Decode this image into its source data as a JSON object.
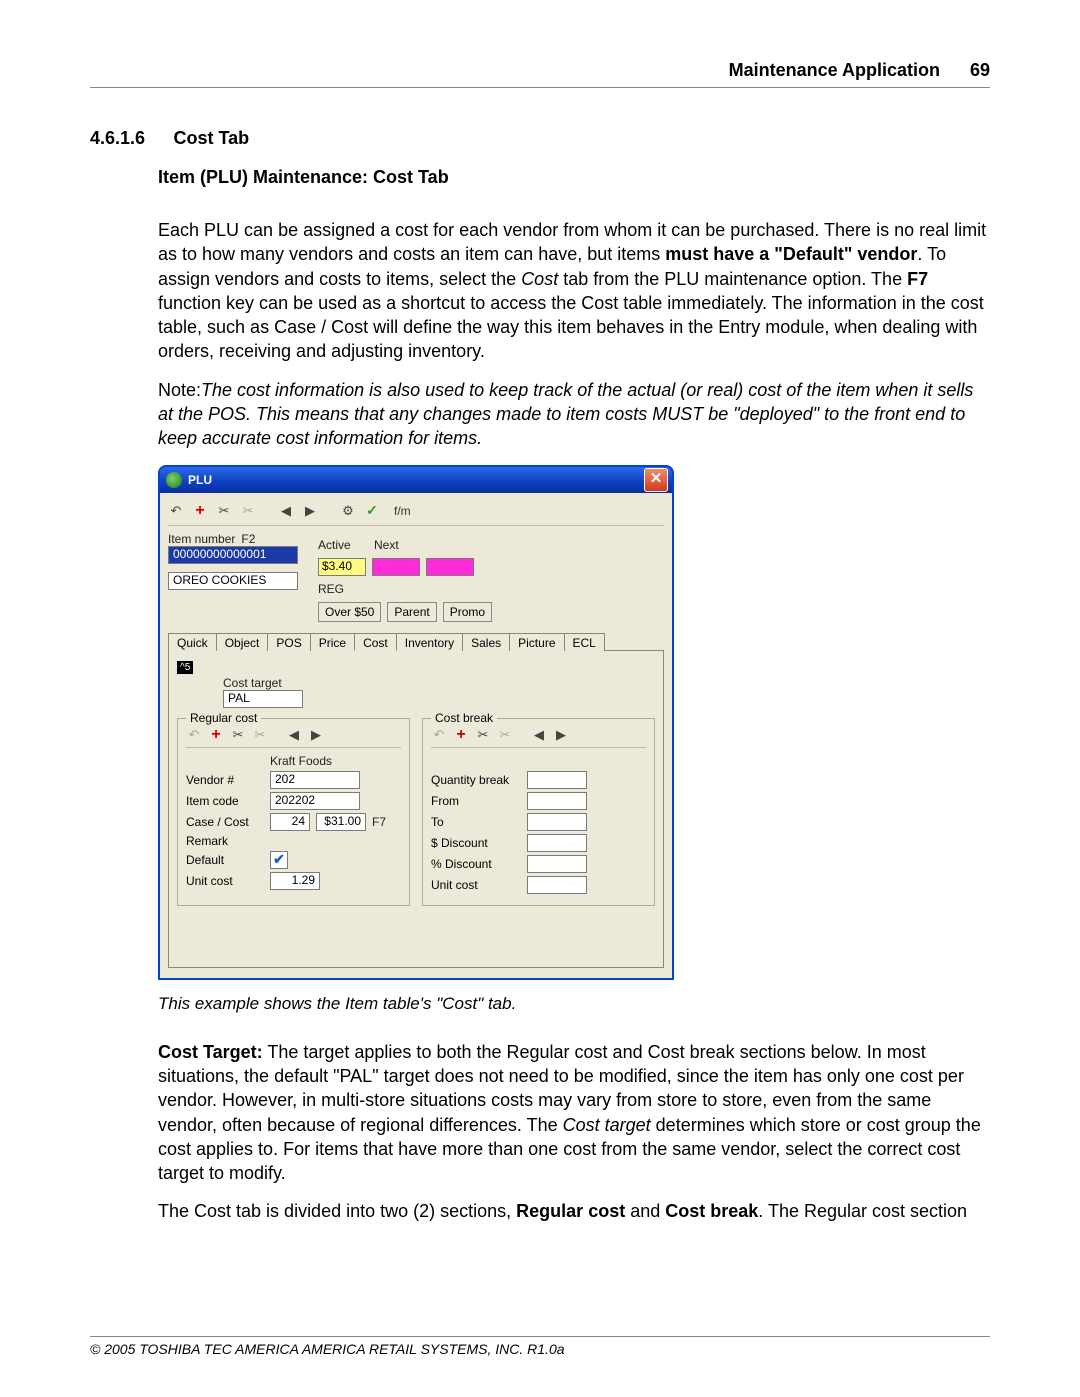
{
  "header": {
    "title": "Maintenance Application",
    "page": "69"
  },
  "section": {
    "num": "4.6.1.6",
    "title": "Cost Tab",
    "subtitle": "Item (PLU) Maintenance: Cost  Tab"
  },
  "para1a": " Each PLU can be assigned a cost for each vendor from whom it can be purchased. There is no real limit as to how many vendors and costs an item can have, but items ",
  "para1_bold": "must have a \"Default\" vendor",
  "para1b": ". To assign vendors and costs to items, select the ",
  "para1_ital": "Cost ",
  "para1c": " tab from the PLU maintenance option. The ",
  "para1_f7": "F7",
  "para1d": " function key can be used as a shortcut to access the Cost table immediately. The information in the cost table, such as Case / Cost will define the way this item behaves in the Entry module, when dealing with orders, receiving and adjusting inventory.",
  "note_label": "Note:",
  "note_body": "The cost information is also used to keep track of the actual (or real) cost of the item when it sells at the POS. This means that any changes made to item costs MUST be \"deployed\" to the front end to keep accurate cost information for items.",
  "caption": "This example shows the Item table's \"Cost\" tab.",
  "para2_label": "Cost Target:",
  "para2a": "  The target applies to both the Regular cost and Cost break sections below. In most situations, the default \"PAL\" target does not need to be modified, since the item has only one cost per vendor. However, in multi-store situations costs may vary from store to store, even from the same vendor, often because of regional differences. The ",
  "para2_ital": "Cost target ",
  "para2b": " determines which store or cost group the cost applies to. For items that have more than one cost from the same vendor, select the correct cost target to modify.",
  "para3a": "The Cost tab is divided into two (2) sections, ",
  "para3_b1": "Regular cost",
  "para3_mid": " and ",
  "para3_b2": "Cost break",
  "para3b": ". The Regular cost section",
  "footer": "© 2005 TOSHIBA TEC AMERICA AMERICA RETAIL SYSTEMS, INC.   R1.0a",
  "plu": {
    "title": "PLU",
    "fm": "f/m",
    "item_number_label": "Item number",
    "f2": "F2",
    "item_number": "00000000000001",
    "desc": "OREO COOKIES",
    "active_label": "Active",
    "next_label": "Next",
    "price": "$3.40",
    "reg": "REG",
    "over50": "Over $50",
    "parent": "Parent",
    "promo": "Promo",
    "tabs": [
      "Quick",
      "Object",
      "POS",
      "Price",
      "Cost",
      "Inventory",
      "Sales",
      "Picture",
      "ECL"
    ],
    "badge": "^5",
    "cost_target_label": "Cost target",
    "cost_target": "PAL",
    "regular_cost": "Regular cost",
    "cost_break": "Cost break",
    "vendor_name": "Kraft Foods",
    "vendor_num_label": "Vendor #",
    "vendor_num": "202",
    "item_code_label": "Item code",
    "item_code": "202202",
    "case_cost_label": "Case / Cost",
    "case_qty": "24",
    "case_cost": "$31.00",
    "f7": "F7",
    "remark_label": "Remark",
    "default_label": "Default",
    "unit_cost_label": "Unit cost",
    "unit_cost": "1.29",
    "qty_break_label": "Quantity break",
    "from_label": "From",
    "to_label": "To",
    "dollar_disc_label": "$ Discount",
    "pct_disc_label": "% Discount",
    "unit_cost2_label": "Unit cost"
  }
}
